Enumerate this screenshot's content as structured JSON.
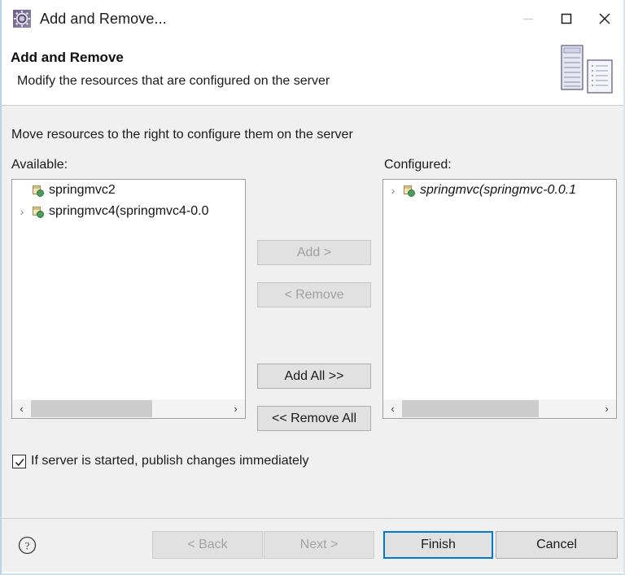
{
  "window": {
    "title": "Add and Remove...",
    "icon": "gear-icon",
    "controls": {
      "minimize": "minimize-icon",
      "maximize": "maximize-icon",
      "close": "close-icon"
    }
  },
  "header": {
    "title": "Add and Remove",
    "subtitle": "Modify the resources that are configured on the server",
    "icon": "server-and-document-icon"
  },
  "body": {
    "instruction": "Move resources to the right to configure them on the server",
    "available": {
      "label": "Available:",
      "items": [
        {
          "label": "springmvc2",
          "icon": "web-module-icon",
          "expandable": false,
          "italic": false
        },
        {
          "label": "springmvc4(springmvc4-0.0",
          "icon": "web-module-icon",
          "expandable": true,
          "italic": false
        }
      ],
      "scrollbar": {
        "left_arrow": "‹",
        "right_arrow": "›",
        "thumb_start_pct": 0,
        "thumb_width_pct": 62
      }
    },
    "configured": {
      "label": "Configured:",
      "items": [
        {
          "label": "springmvc(springmvc-0.0.1",
          "icon": "web-module-icon",
          "expandable": true,
          "italic": true
        }
      ],
      "scrollbar": {
        "left_arrow": "‹",
        "right_arrow": "›",
        "thumb_start_pct": 0,
        "thumb_width_pct": 70
      }
    },
    "transfer_buttons": [
      {
        "label": "Add >",
        "enabled": false
      },
      {
        "label": "< Remove",
        "enabled": false
      },
      {
        "label": "Add All >>",
        "enabled": true
      },
      {
        "label": "<< Remove All",
        "enabled": true
      }
    ],
    "publish_checkbox": {
      "label": "If server is started, publish changes immediately",
      "checked": true
    }
  },
  "footer": {
    "help_icon": "help-icon",
    "buttons": {
      "back": {
        "label": "< Back",
        "enabled": false
      },
      "next": {
        "label": "Next >",
        "enabled": false
      },
      "finish": {
        "label": "Finish",
        "enabled": true,
        "focused": true
      },
      "cancel": {
        "label": "Cancel",
        "enabled": true
      }
    }
  },
  "colors": {
    "accent": "#0078d7",
    "body_bg": "#f0f0f0",
    "list_bg": "#ffffff",
    "button_bg": "#e1e1e1",
    "disabled_text": "#a0a0a0"
  }
}
